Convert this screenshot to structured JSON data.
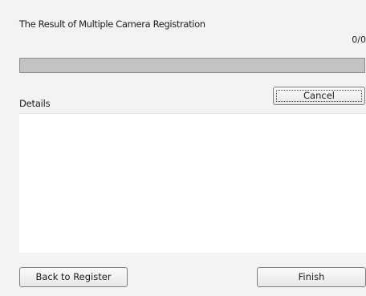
{
  "dialog": {
    "title": "The Result of Multiple Camera Registration",
    "counter": "0/0",
    "progress": {
      "fraction": 0
    },
    "cancel_label": "Cancel",
    "details_label": "Details",
    "details_text": "",
    "back_label": "Back to Register",
    "finish_label": "Finish"
  }
}
